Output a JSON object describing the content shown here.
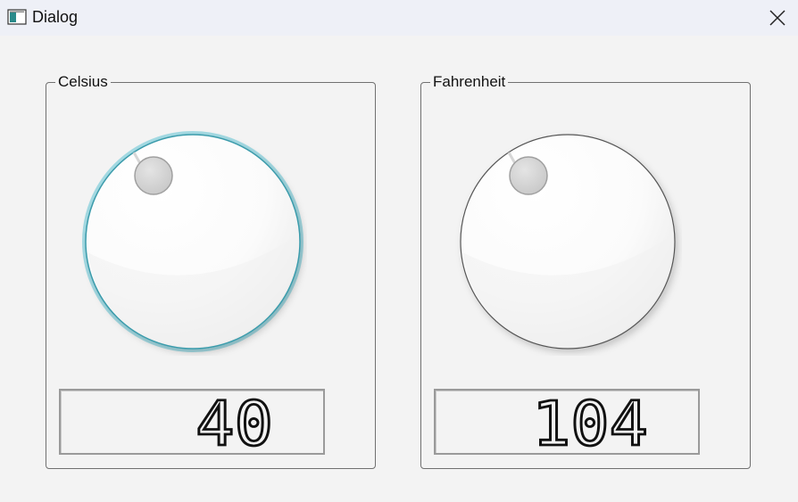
{
  "window": {
    "title": "Dialog"
  },
  "celsius": {
    "label": "Celsius",
    "value": "40"
  },
  "fahrenheit": {
    "label": "Fahrenheit",
    "value": "104"
  },
  "colors": {
    "focus_ring": "#5ab8c8",
    "lcd_digit": "#111111",
    "lcd_border": "#9a9a9a"
  },
  "icons": {
    "app": "window-app-icon",
    "close": "close-icon"
  }
}
